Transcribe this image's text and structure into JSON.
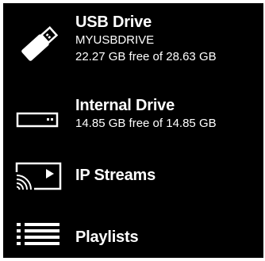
{
  "locations": [
    {
      "title": "USB Drive",
      "volume_label": "MYUSBDRIVE",
      "space": "22.27 GB free of 28.63 GB",
      "icon": "usb-drive-icon"
    },
    {
      "title": "Internal Drive",
      "space": "14.85 GB free of 14.85 GB",
      "icon": "internal-drive-icon"
    },
    {
      "title": "IP Streams",
      "icon": "cast-stream-icon"
    },
    {
      "title": "Playlists",
      "icon": "playlist-icon"
    }
  ],
  "colors": {
    "background": "#000000",
    "text": "#ffffff",
    "border": "#ffffff"
  }
}
